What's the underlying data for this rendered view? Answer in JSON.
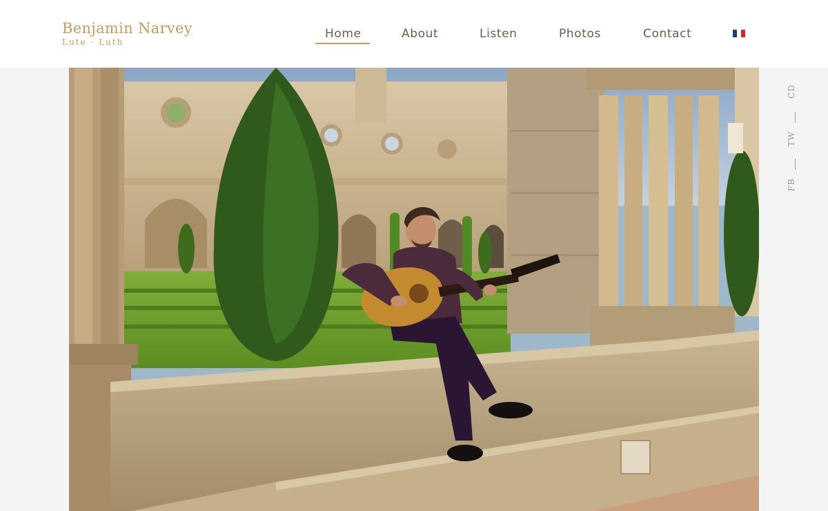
{
  "site": {
    "logo_name": "Benjamin Narvey",
    "logo_tagline": "Lute · Luth"
  },
  "nav": {
    "items": [
      {
        "label": "Home",
        "active": true
      },
      {
        "label": "About"
      },
      {
        "label": "Listen"
      },
      {
        "label": "Photos"
      },
      {
        "label": "Contact"
      }
    ],
    "language_flag": "flag-france-icon"
  },
  "social": {
    "links": [
      "CD",
      "TW",
      "FB"
    ]
  },
  "hero": {
    "image": "photo-lutenist-in-cloister"
  },
  "colors": {
    "accent": "#c79a55",
    "nav_text": "#6a5d52",
    "header_bg": "#ffffff",
    "page_bg": "#f4f4f4",
    "social_text": "#9a9a9a",
    "flag_blue": "#1f3a93",
    "flag_white": "#ffffff",
    "flag_red": "#d62828"
  }
}
